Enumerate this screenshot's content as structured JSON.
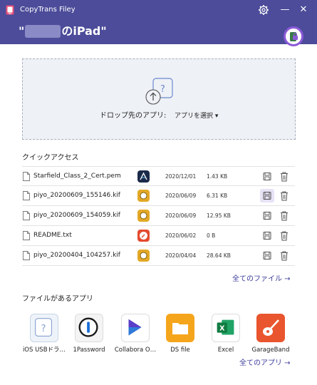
{
  "window": {
    "title": "CopyTrans Filey",
    "minimize": "—",
    "close": "✕"
  },
  "device": {
    "name_prefix": "\"",
    "name_suffix": "のiPad\""
  },
  "drop_zone": {
    "label": "ドロップ先のアプリ:",
    "select_label": "アプリを選択 ▾"
  },
  "quick_access": {
    "title": "クイックアクセス",
    "files": [
      {
        "name": "Starfield_Class_2_Cert.pem",
        "date": "2020/12/01",
        "size": "1.43 KB",
        "app_icon": "notation-app-icon",
        "app_color": "#1b2a4a"
      },
      {
        "name": "piyo_20200609_155146.kif",
        "date": "2020/06/09",
        "size": "6.31 KB",
        "app_icon": "shogi-app-icon",
        "app_color": "#e3a826"
      },
      {
        "name": "piyo_20200609_154059.kif",
        "date": "2020/06/09",
        "size": "12.95 KB",
        "app_icon": "shogi-app-icon",
        "app_color": "#e3a826"
      },
      {
        "name": "README.txt",
        "date": "2020/06/02",
        "size": "0 B",
        "app_icon": "compass-app-icon",
        "app_color": "#e44a2e"
      },
      {
        "name": "piyo_20200404_104257.kif",
        "date": "2020/04/04",
        "size": "28.64 KB",
        "app_icon": "shogi-app-icon",
        "app_color": "#e3a826"
      }
    ],
    "all_files_link": "全てのファイル →"
  },
  "apps_section": {
    "title": "ファイルがあるアプリ",
    "apps": [
      {
        "name": "iOS USBドラ…",
        "icon": "question-app-icon"
      },
      {
        "name": "1Password",
        "icon": "onepassword-app-icon"
      },
      {
        "name": "Collabora O…",
        "icon": "collabora-app-icon"
      },
      {
        "name": "DS file",
        "icon": "folder-app-icon"
      },
      {
        "name": "Excel",
        "icon": "excel-app-icon"
      },
      {
        "name": "GarageBand",
        "icon": "guitar-app-icon"
      }
    ],
    "all_apps_link": "全てのアプリ →"
  },
  "colors": {
    "header": "#4c4c9a",
    "link": "#3a3a9a",
    "drop_bg": "#eef1f6",
    "highlight": "#e7e2f5"
  }
}
